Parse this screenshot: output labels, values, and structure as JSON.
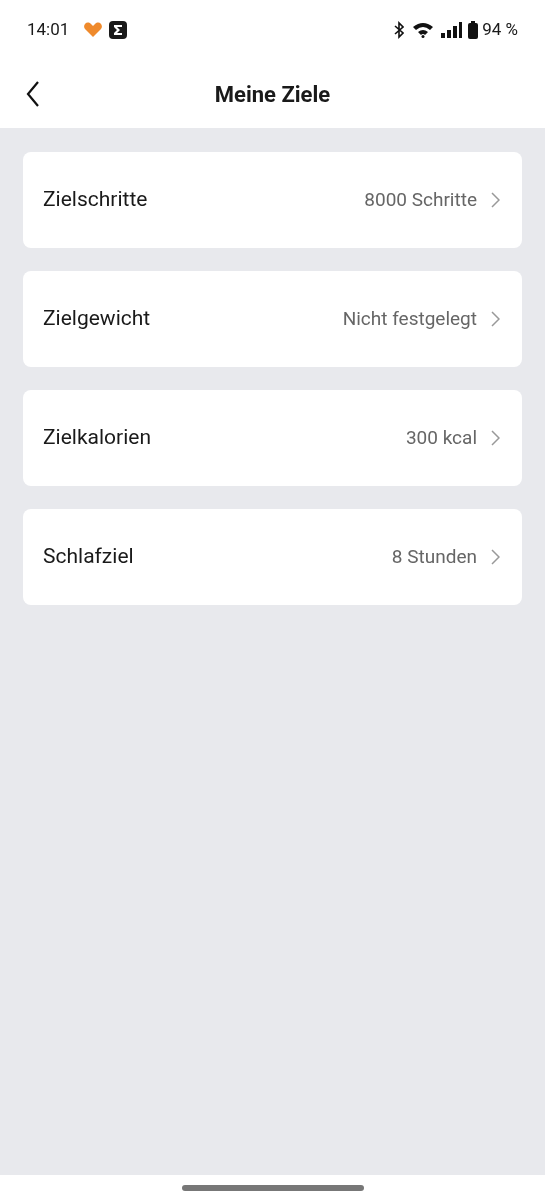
{
  "status_bar": {
    "time": "14:01",
    "battery": "94 %"
  },
  "header": {
    "title": "Meine Ziele"
  },
  "goals": [
    {
      "label": "Zielschritte",
      "value": "8000 Schritte"
    },
    {
      "label": "Zielgewicht",
      "value": "Nicht festgelegt"
    },
    {
      "label": "Zielkalorien",
      "value": "300 kcal"
    },
    {
      "label": "Schlafziel",
      "value": "8 Stunden"
    }
  ]
}
